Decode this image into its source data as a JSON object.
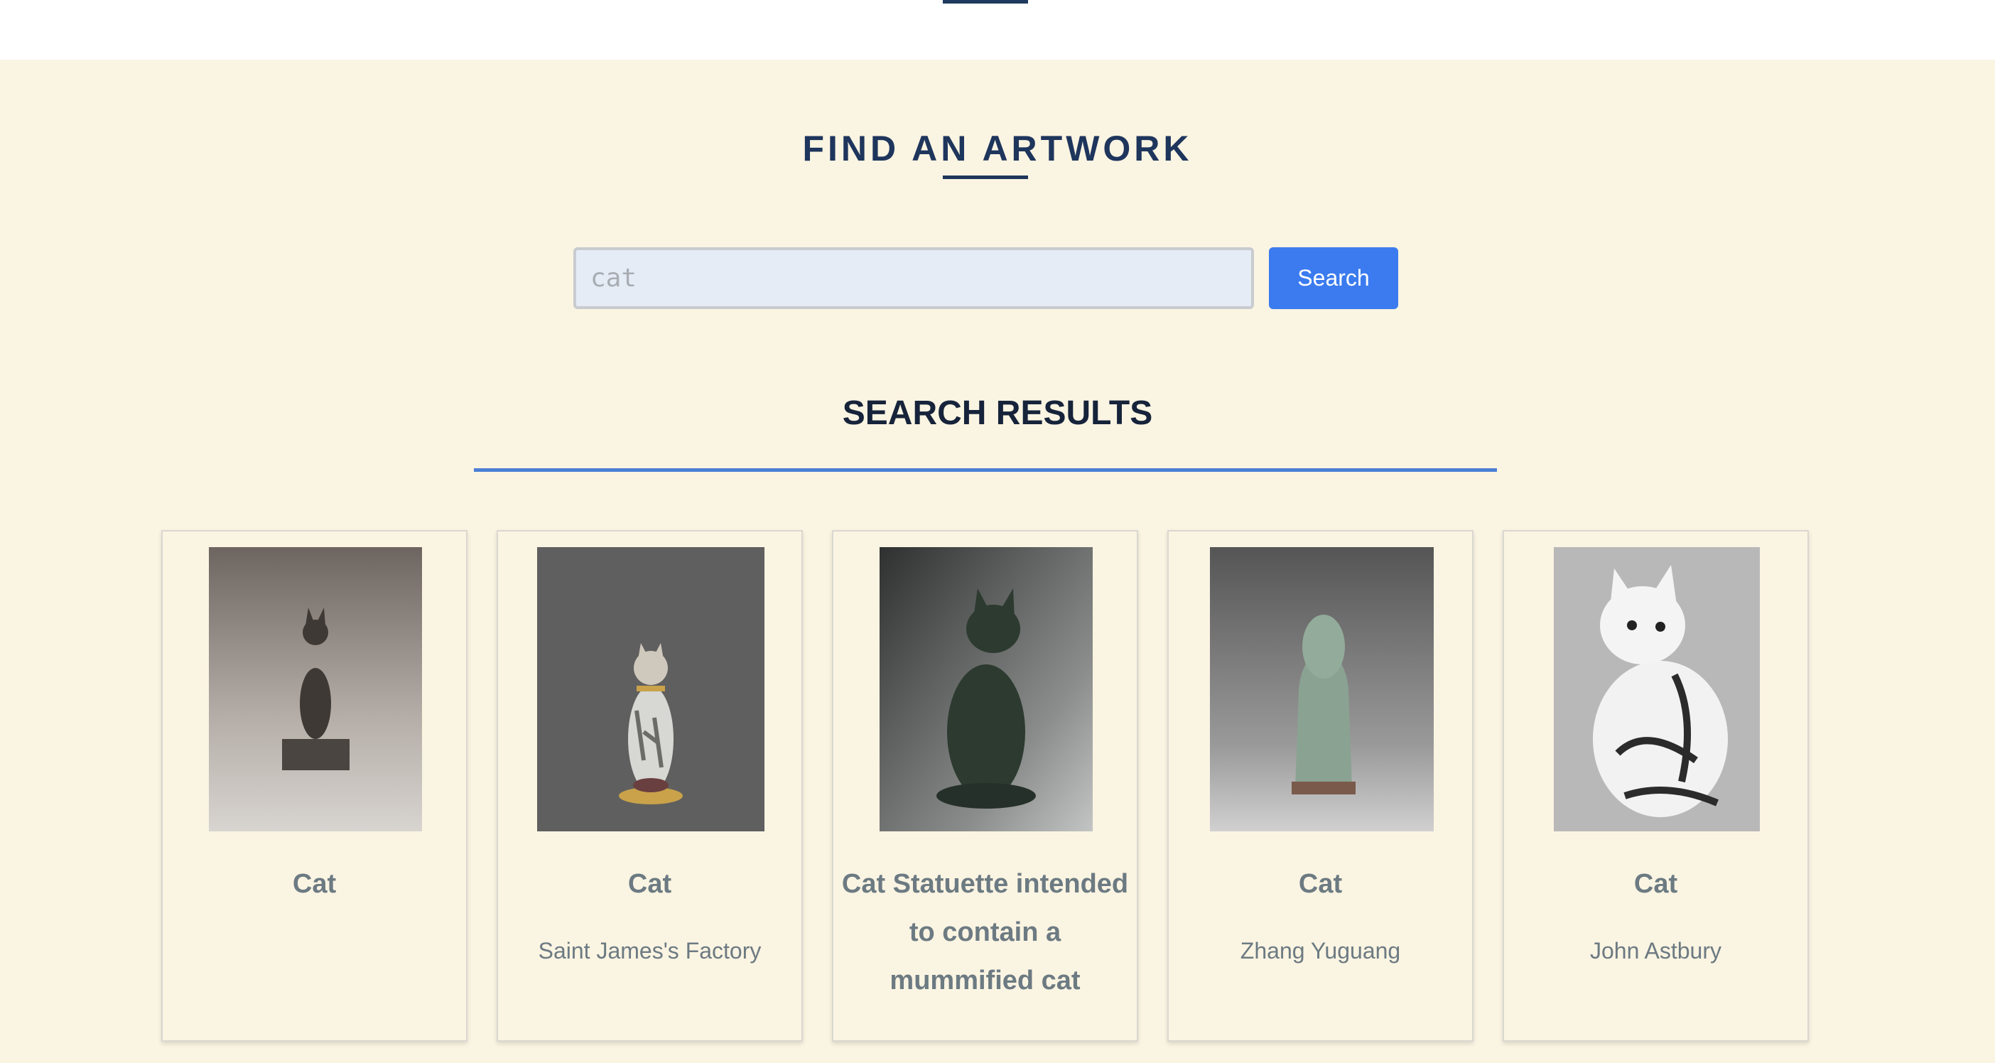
{
  "search": {
    "heading": "FIND AN ARTWORK",
    "placeholder": "cat",
    "value": "",
    "button_label": "Search"
  },
  "results": {
    "heading": "SEARCH RESULTS",
    "items": [
      {
        "title": "Cat",
        "artist": ""
      },
      {
        "title": "Cat",
        "artist": "Saint James's Factory"
      },
      {
        "title": "Cat Statuette intended to contain a mummified cat",
        "artist": ""
      },
      {
        "title": "Cat",
        "artist": "Zhang Yuguang"
      },
      {
        "title": "Cat",
        "artist": "John Astbury"
      }
    ]
  },
  "colors": {
    "page_background": "#faf4e2",
    "heading": "#1e355c",
    "accent": "#3b7bef",
    "rule": "#4a7fd6",
    "card_text": "#6c7a82"
  },
  "icons": [
    "cat-figurine-image"
  ]
}
